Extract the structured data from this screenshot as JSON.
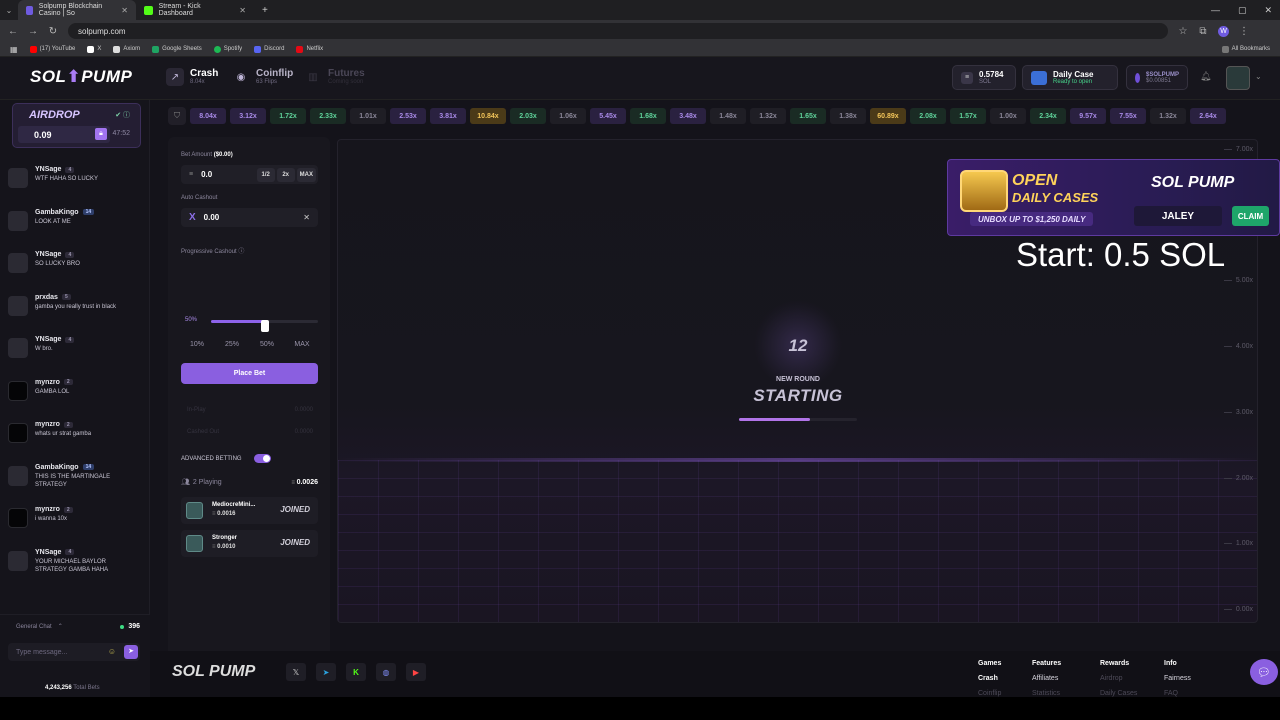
{
  "browser": {
    "tabs": [
      {
        "label": "Solpump Blockchain Casino | So",
        "color": "#6f5be0"
      },
      {
        "label": "Stream - Kick Dashboard",
        "color": "#53fc18"
      }
    ],
    "url": "solpump.com",
    "bookmarks": [
      {
        "label": "(17) YouTube",
        "color": "#ff0000"
      },
      {
        "label": "X",
        "color": "#ffffff"
      },
      {
        "label": "Axiom",
        "color": "#ffffff"
      },
      {
        "label": "Google Sheets",
        "color": "#1fa463"
      },
      {
        "label": "Spotify",
        "color": "#1db954"
      },
      {
        "label": "Discord",
        "color": "#5865f2"
      },
      {
        "label": "Netflix",
        "color": "#e50914"
      }
    ],
    "all_bookmarks": "All Bookmarks"
  },
  "header": {
    "logo_left": "SOL",
    "logo_right": "PUMP",
    "nav": [
      {
        "title": "Crash",
        "sub": "8.04x",
        "icon": "chart-icon"
      },
      {
        "title": "Coinflip",
        "sub": "63 Flips",
        "icon": "coin-icon"
      },
      {
        "title": "Futures",
        "sub": "Coming soon",
        "icon": "futures-icon"
      }
    ],
    "balance": {
      "value": "0.5784",
      "unit": "SOL"
    },
    "daily_case": {
      "title": "Daily Case",
      "status": "Ready to open"
    },
    "token": {
      "name": "$SOLPUMP",
      "price": "$0.00851"
    }
  },
  "airdrop": {
    "title": "AIRDROP",
    "amount": "0.09",
    "time": "47:52"
  },
  "chat": {
    "messages": [
      {
        "name": "YNSage",
        "level": "4",
        "text": "WTF HAHA SO LUCKY",
        "avatar": "icon"
      },
      {
        "name": "GambaKingo",
        "level": "14",
        "text": "LOOK AT ME",
        "avatar": "pixel"
      },
      {
        "name": "YNSage",
        "level": "4",
        "text": "SO LUCKY BRO",
        "avatar": "icon"
      },
      {
        "name": "prxdas",
        "level": "5",
        "text": "gamba you really trust in black",
        "avatar": "pixel"
      },
      {
        "name": "YNSage",
        "level": "4",
        "text": "W bro.",
        "avatar": "icon"
      },
      {
        "name": "mynzro",
        "level": "2",
        "text": "GAMBA LOL",
        "avatar": "dark"
      },
      {
        "name": "mynzro",
        "level": "2",
        "text": "whats ur strat gamba",
        "avatar": "dark"
      },
      {
        "name": "GambaKingo",
        "level": "14",
        "text": "THIS IS THE MARTINGALE STRATEGY",
        "avatar": "pixel"
      },
      {
        "name": "mynzro",
        "level": "2",
        "text": "i wanna 10x",
        "avatar": "dark"
      },
      {
        "name": "YNSage",
        "level": "4",
        "text": "YOUR MICHAEL BAYLOR STRATEGY GAMBA HAHA",
        "avatar": "icon"
      }
    ],
    "channel": "General Chat",
    "online": "396",
    "input_placeholder": "Type message...",
    "total_bets_value": "4,243,256",
    "total_bets_label": "Total Bets"
  },
  "history": [
    {
      "v": "8.04x",
      "c": "purple"
    },
    {
      "v": "3.12x",
      "c": "purple"
    },
    {
      "v": "1.72x",
      "c": "green"
    },
    {
      "v": "2.33x",
      "c": "green"
    },
    {
      "v": "1.01x",
      "c": "gray"
    },
    {
      "v": "2.53x",
      "c": "purple"
    },
    {
      "v": "3.81x",
      "c": "purple"
    },
    {
      "v": "10.84x",
      "c": "gold"
    },
    {
      "v": "2.03x",
      "c": "green"
    },
    {
      "v": "1.06x",
      "c": "gray"
    },
    {
      "v": "5.45x",
      "c": "purple"
    },
    {
      "v": "1.68x",
      "c": "green"
    },
    {
      "v": "3.48x",
      "c": "purple"
    },
    {
      "v": "1.48x",
      "c": "gray"
    },
    {
      "v": "1.32x",
      "c": "gray"
    },
    {
      "v": "1.65x",
      "c": "green"
    },
    {
      "v": "1.38x",
      "c": "gray"
    },
    {
      "v": "60.89x",
      "c": "gold"
    },
    {
      "v": "2.08x",
      "c": "green"
    },
    {
      "v": "1.57x",
      "c": "green"
    },
    {
      "v": "1.00x",
      "c": "gray"
    },
    {
      "v": "2.34x",
      "c": "green"
    },
    {
      "v": "9.57x",
      "c": "purple"
    },
    {
      "v": "7.55x",
      "c": "purple"
    },
    {
      "v": "1.32x",
      "c": "gray"
    },
    {
      "v": "2.64x",
      "c": "purple"
    }
  ],
  "bet": {
    "amount_label": "Bet Amount",
    "amount_usd": "($0.00)",
    "amount_value": "0.0",
    "half": "1/2",
    "double": "2x",
    "max": "MAX",
    "auto_cashout_label": "Auto Cashout",
    "auto_cashout_value": "0.00",
    "progressive_label": "Progressive Cashout",
    "progressive_pct": "50%",
    "progressive_fraction": 0.5,
    "pcts": [
      "10%",
      "25%",
      "50%",
      "MAX"
    ],
    "place_label": "Place Bet",
    "in_play_label": "In-Play",
    "in_play_value": "0.0000",
    "cashed_out_label": "Cashed Out",
    "cashed_out_value": "0.0000",
    "advanced_label": "ADVANCED BETTING",
    "playing_label": "2 Playing",
    "playing_total": "0.0026",
    "players": [
      {
        "name": "MediocreMini...",
        "amount": "0.0016",
        "status": "JOINED"
      },
      {
        "name": "Stronger",
        "amount": "0.0010",
        "status": "JOINED"
      }
    ]
  },
  "game": {
    "countdown": "12",
    "round_label": "NEW ROUND",
    "state": "STARTING",
    "progress_fraction": 0.6,
    "yaxis": [
      "7.00x",
      "6.00x",
      "5.00x",
      "4.00x",
      "3.00x",
      "2.00x",
      "1.00x",
      "0.00x"
    ]
  },
  "ad": {
    "line1": "OPEN",
    "line2": "DAILY CASES",
    "unbox": "UNBOX UP TO $1,250 DAILY",
    "brand": "SOL PUMP",
    "code": "JALEY",
    "claim": "CLAIM"
  },
  "overlay_text": "Start: 0.5 SOL",
  "footer": {
    "logo": "SOL PUMP",
    "columns": [
      {
        "title": "Games",
        "items": [
          "Crash",
          "Coinflip"
        ]
      },
      {
        "title": "Features",
        "items": [
          "Affiliates",
          "Statistics"
        ]
      },
      {
        "title": "Rewards",
        "items": [
          "Airdrop",
          "Daily Cases"
        ]
      },
      {
        "title": "Info",
        "items": [
          "Fairness",
          "FAQ"
        ]
      }
    ]
  }
}
